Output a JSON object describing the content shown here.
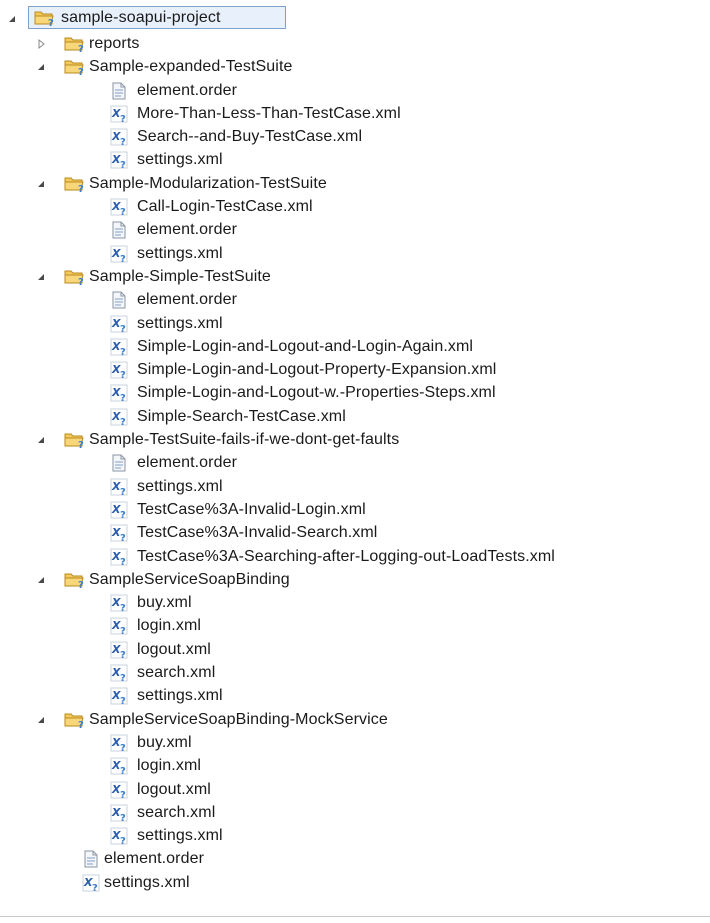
{
  "tree": {
    "root": {
      "label": "sample-soapui-project",
      "expanded": true,
      "icon": "project-folder-icon"
    },
    "items": [
      {
        "level": 1,
        "type": "folder",
        "expanded": false,
        "label": "reports"
      },
      {
        "level": 1,
        "type": "folder",
        "expanded": true,
        "label": "Sample-expanded-TestSuite"
      },
      {
        "level": 2,
        "type": "file",
        "label": "element.order"
      },
      {
        "level": 2,
        "type": "xml",
        "label": "More-Than-Less-Than-TestCase.xml"
      },
      {
        "level": 2,
        "type": "xml",
        "label": "Search--and-Buy-TestCase.xml"
      },
      {
        "level": 2,
        "type": "xml",
        "label": "settings.xml"
      },
      {
        "level": 1,
        "type": "folder",
        "expanded": true,
        "label": "Sample-Modularization-TestSuite"
      },
      {
        "level": 2,
        "type": "xml",
        "label": "Call-Login-TestCase.xml"
      },
      {
        "level": 2,
        "type": "file",
        "label": "element.order"
      },
      {
        "level": 2,
        "type": "xml",
        "label": "settings.xml"
      },
      {
        "level": 1,
        "type": "folder",
        "expanded": true,
        "label": "Sample-Simple-TestSuite"
      },
      {
        "level": 2,
        "type": "file",
        "label": "element.order"
      },
      {
        "level": 2,
        "type": "xml",
        "label": "settings.xml"
      },
      {
        "level": 2,
        "type": "xml",
        "label": "Simple-Login-and-Logout-and-Login-Again.xml"
      },
      {
        "level": 2,
        "type": "xml",
        "label": "Simple-Login-and-Logout-Property-Expansion.xml"
      },
      {
        "level": 2,
        "type": "xml",
        "label": "Simple-Login-and-Logout-w.-Properties-Steps.xml"
      },
      {
        "level": 2,
        "type": "xml",
        "label": "Simple-Search-TestCase.xml"
      },
      {
        "level": 1,
        "type": "folder",
        "expanded": true,
        "label": "Sample-TestSuite-fails-if-we-dont-get-faults"
      },
      {
        "level": 2,
        "type": "file",
        "label": "element.order"
      },
      {
        "level": 2,
        "type": "xml",
        "label": "settings.xml"
      },
      {
        "level": 2,
        "type": "xml",
        "label": "TestCase%3A-Invalid-Login.xml"
      },
      {
        "level": 2,
        "type": "xml",
        "label": "TestCase%3A-Invalid-Search.xml"
      },
      {
        "level": 2,
        "type": "xml",
        "label": "TestCase%3A-Searching-after-Logging-out-LoadTests.xml"
      },
      {
        "level": 1,
        "type": "folder",
        "expanded": true,
        "label": "SampleServiceSoapBinding"
      },
      {
        "level": 2,
        "type": "xml",
        "label": "buy.xml"
      },
      {
        "level": 2,
        "type": "xml",
        "label": "login.xml"
      },
      {
        "level": 2,
        "type": "xml",
        "label": "logout.xml"
      },
      {
        "level": 2,
        "type": "xml",
        "label": "search.xml"
      },
      {
        "level": 2,
        "type": "xml",
        "label": "settings.xml"
      },
      {
        "level": 1,
        "type": "folder",
        "expanded": true,
        "label": "SampleServiceSoapBinding-MockService"
      },
      {
        "level": 2,
        "type": "xml",
        "label": "buy.xml"
      },
      {
        "level": 2,
        "type": "xml",
        "label": "login.xml"
      },
      {
        "level": 2,
        "type": "xml",
        "label": "logout.xml"
      },
      {
        "level": 2,
        "type": "xml",
        "label": "search.xml"
      },
      {
        "level": 2,
        "type": "xml",
        "label": "settings.xml"
      },
      {
        "level": 1,
        "type": "file",
        "label": "element.order"
      },
      {
        "level": 1,
        "type": "xml",
        "label": "settings.xml"
      }
    ]
  },
  "colors": {
    "folder_fill": "#f3c95b",
    "folder_stroke": "#b98a1e",
    "selection_border": "#7da2ce",
    "selection_fill": "#e8f1fb",
    "xml_badge": "#2a5db0",
    "question_mark": "#3a7fd0"
  }
}
